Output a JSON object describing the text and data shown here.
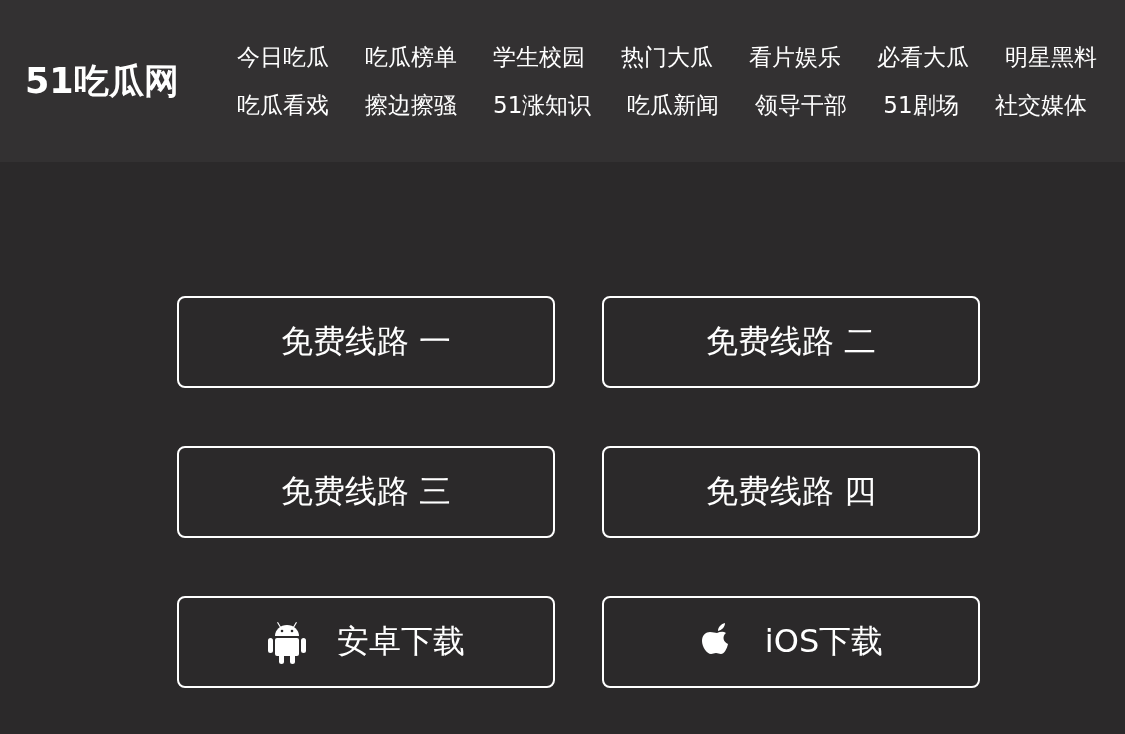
{
  "header": {
    "logo": "51吃瓜网",
    "nav_rows": [
      [
        "今日吃瓜",
        "吃瓜榜单",
        "学生校园",
        "热门大瓜",
        "看片娱乐",
        "必看大瓜",
        "明星黑料"
      ],
      [
        "吃瓜看戏",
        "擦边擦骚",
        "51涨知识",
        "吃瓜新闻",
        "领导干部",
        "51剧场",
        "社交媒体"
      ]
    ]
  },
  "buttons": [
    {
      "kind": "route",
      "label": "免费线路 一"
    },
    {
      "kind": "route",
      "label": "免费线路 二"
    },
    {
      "kind": "route",
      "label": "免费线路 三"
    },
    {
      "kind": "route",
      "label": "免费线路 四"
    },
    {
      "kind": "android",
      "label": "安卓下载"
    },
    {
      "kind": "ios",
      "label": "iOS下载"
    }
  ]
}
